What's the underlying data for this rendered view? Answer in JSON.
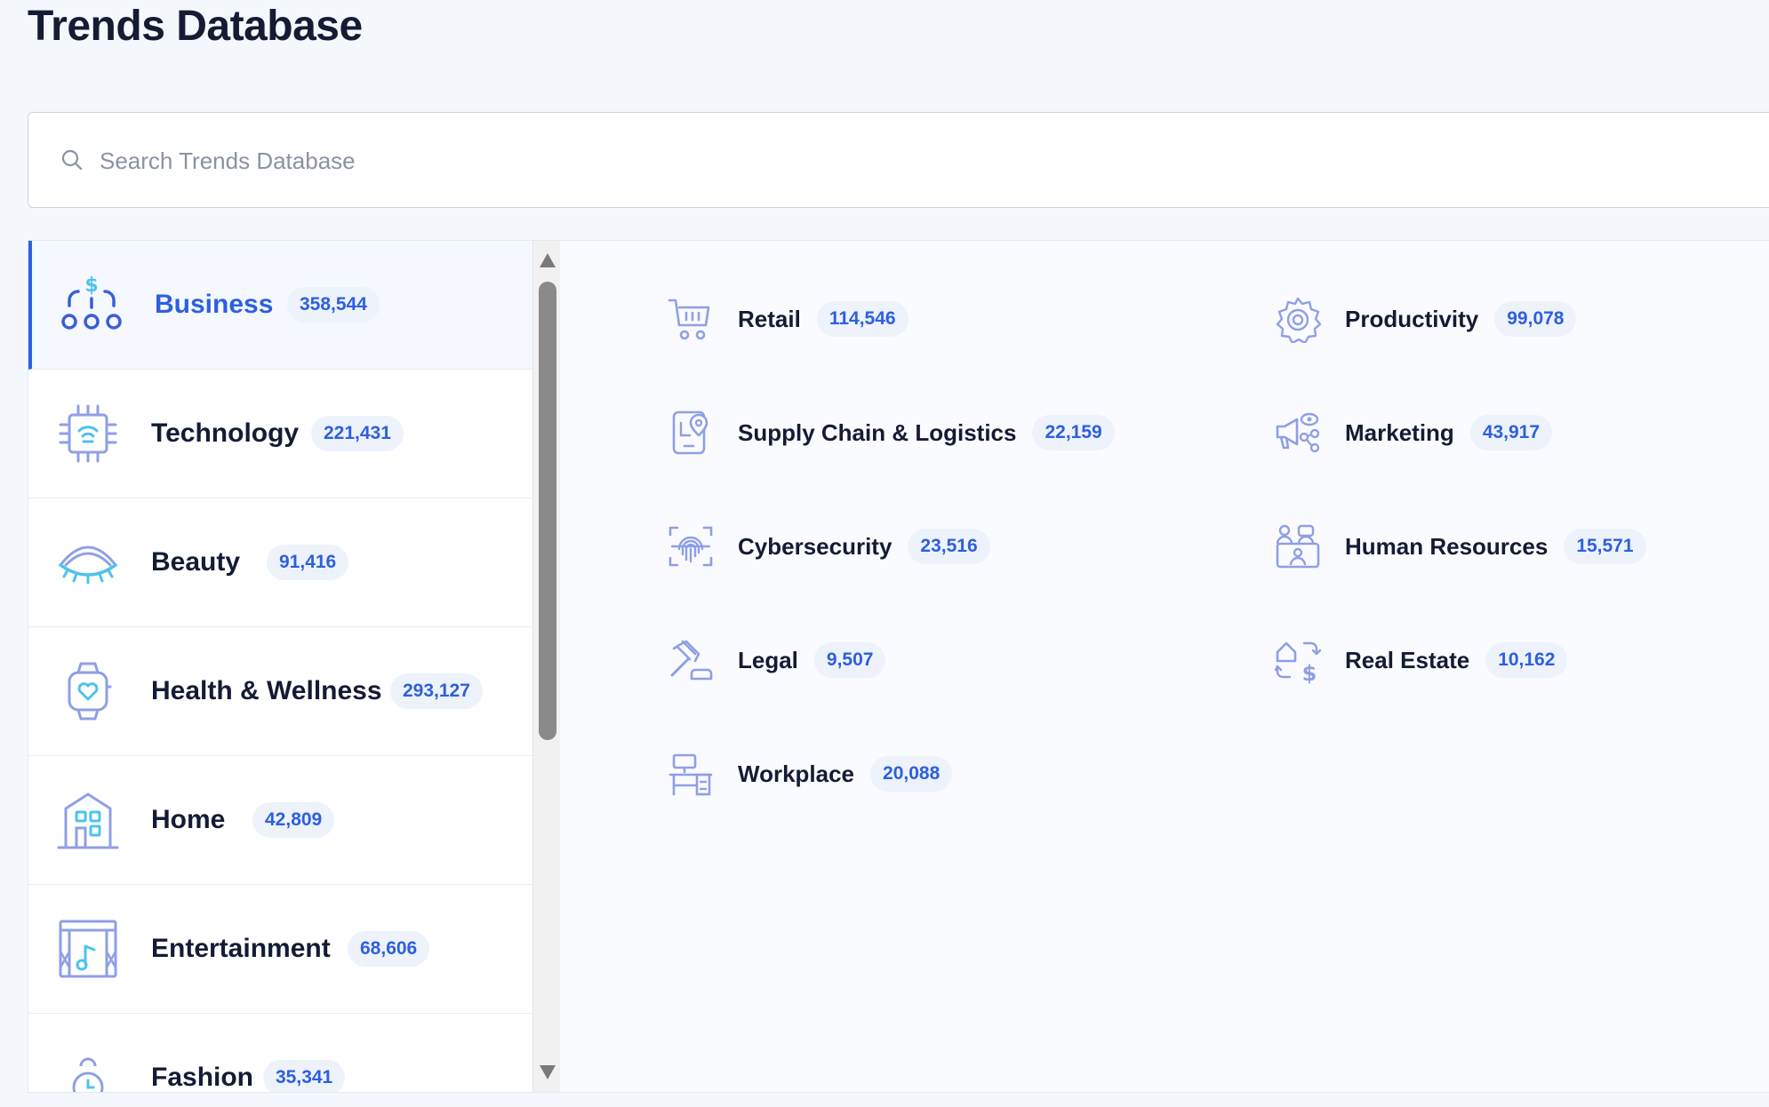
{
  "page": {
    "title": "Trends Database"
  },
  "search": {
    "placeholder": "Search Trends Database",
    "value": ""
  },
  "categories": [
    {
      "label": "Business",
      "count": "358,544",
      "icon": "business-icon",
      "active": true
    },
    {
      "label": "Technology",
      "count": "221,431",
      "icon": "chip-icon",
      "active": false
    },
    {
      "label": "Beauty",
      "count": "91,416",
      "icon": "eyelash-icon",
      "active": false
    },
    {
      "label": "Health & Wellness",
      "count": "293,127",
      "icon": "smartwatch-heart-icon",
      "active": false
    },
    {
      "label": "Home",
      "count": "42,809",
      "icon": "house-icon",
      "active": false
    },
    {
      "label": "Entertainment",
      "count": "68,606",
      "icon": "stage-music-icon",
      "active": false
    },
    {
      "label": "Fashion",
      "count": "35,341",
      "icon": "handbag-icon",
      "active": false
    }
  ],
  "subcategories": [
    {
      "label": "Retail",
      "count": "114,546",
      "icon": "cart-icon"
    },
    {
      "label": "Productivity",
      "count": "99,078",
      "icon": "gear-icon"
    },
    {
      "label": "Supply Chain & Logistics",
      "count": "22,159",
      "icon": "map-pin-phone-icon"
    },
    {
      "label": "Marketing",
      "count": "43,917",
      "icon": "megaphone-icon"
    },
    {
      "label": "Cybersecurity",
      "count": "23,516",
      "icon": "fingerprint-icon"
    },
    {
      "label": "Human Resources",
      "count": "15,571",
      "icon": "people-icon"
    },
    {
      "label": "Legal",
      "count": "9,507",
      "icon": "gavel-icon"
    },
    {
      "label": "Real Estate",
      "count": "10,162",
      "icon": "house-dollar-icon"
    },
    {
      "label": "Workplace",
      "count": "20,088",
      "icon": "desk-icon"
    }
  ],
  "colors": {
    "accent": "#2d5fe0",
    "icon_stroke": "#8f9fe6",
    "icon_accent": "#4cc3ec"
  }
}
